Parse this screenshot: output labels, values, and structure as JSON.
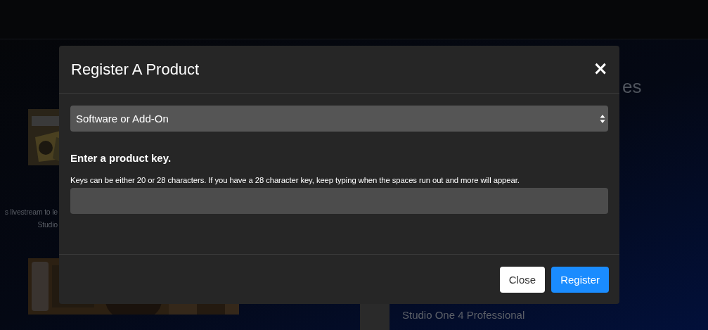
{
  "background": {
    "left_texts": [
      "s livestream to le",
      "Studio"
    ],
    "heading": "es",
    "product": {
      "title": "Studio One 4 Professional"
    }
  },
  "modal": {
    "title": "Register A Product",
    "close_icon": "×",
    "product_type": {
      "value": "Software or Add-On"
    },
    "key_label": "Enter a product key.",
    "help": "Keys can be either 20 or 28 characters. If you have a 28 character key, keep typing when the spaces run out and more will appear.",
    "buttons": [
      {
        "label": "Close",
        "kind": "secondary"
      },
      {
        "label": "Register",
        "kind": "primary"
      }
    ]
  }
}
